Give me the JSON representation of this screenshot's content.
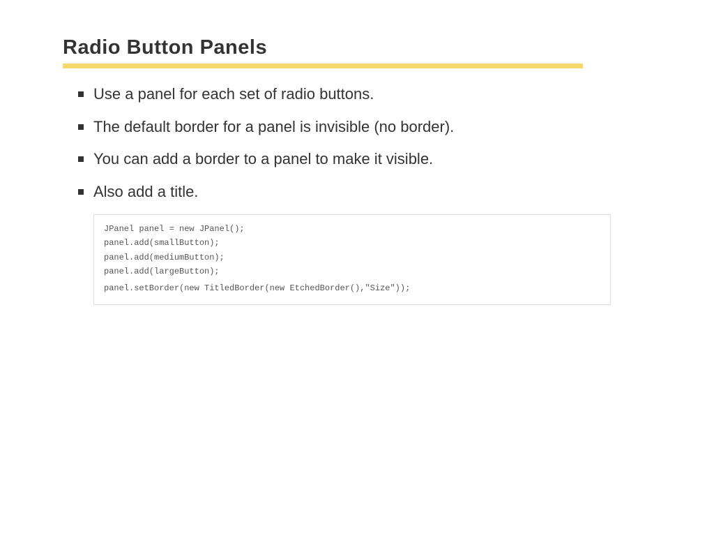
{
  "title": "Radio Button Panels",
  "bullets": [
    "Use a panel for each set of radio buttons.",
    "The default border for a panel is invisible (no border).",
    "You can add a border to a panel to make it visible.",
    "Also add a title."
  ],
  "code": {
    "line1": "JPanel panel = new JPanel();",
    "line2": "panel.add(smallButton);",
    "line3": "panel.add(mediumButton);",
    "line4": "panel.add(largeButton);",
    "line5": "panel.setBorder(new TitledBorder(new EtchedBorder(),\"Size\"));"
  }
}
